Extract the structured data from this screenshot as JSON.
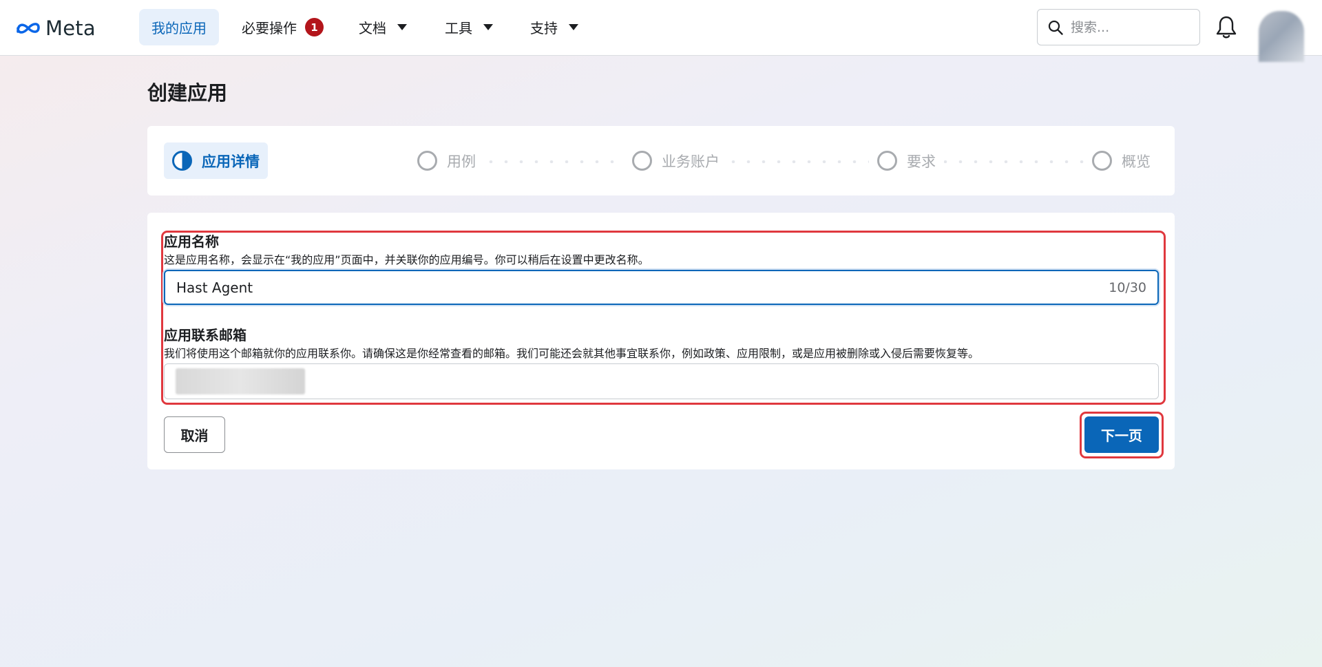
{
  "brand": {
    "name": "Meta"
  },
  "nav": {
    "items": [
      {
        "label": "我的应用",
        "active": true
      },
      {
        "label": "必要操作",
        "badge": "1"
      },
      {
        "label": "文档",
        "dropdown": true
      },
      {
        "label": "工具",
        "dropdown": true
      },
      {
        "label": "支持",
        "dropdown": true
      }
    ],
    "search_placeholder": "搜索..."
  },
  "page": {
    "title": "创建应用"
  },
  "stepper": {
    "steps": [
      {
        "label": "应用详情",
        "state": "current"
      },
      {
        "label": "用例",
        "state": "pending"
      },
      {
        "label": "业务账户",
        "state": "pending"
      },
      {
        "label": "要求",
        "state": "pending"
      },
      {
        "label": "概览",
        "state": "pending"
      }
    ]
  },
  "form": {
    "app_name": {
      "label": "应用名称",
      "help": "这是应用名称，会显示在“我的应用”页面中，并关联你的应用编号。你可以稍后在设置中更改名称。",
      "value": "Hast Agent",
      "counter": "10/30"
    },
    "contact_email": {
      "label": "应用联系邮箱",
      "help": "我们将使用这个邮箱就你的应用联系你。请确保这是你经常查看的邮箱。我们可能还会就其他事宜联系你，例如政策、应用限制，或是应用被删除或入侵后需要恢复等。"
    },
    "cancel_label": "取消",
    "next_label": "下一页"
  },
  "colors": {
    "accent": "#0a66b8",
    "badge": "#b3151b",
    "highlight": "#e0383e"
  }
}
